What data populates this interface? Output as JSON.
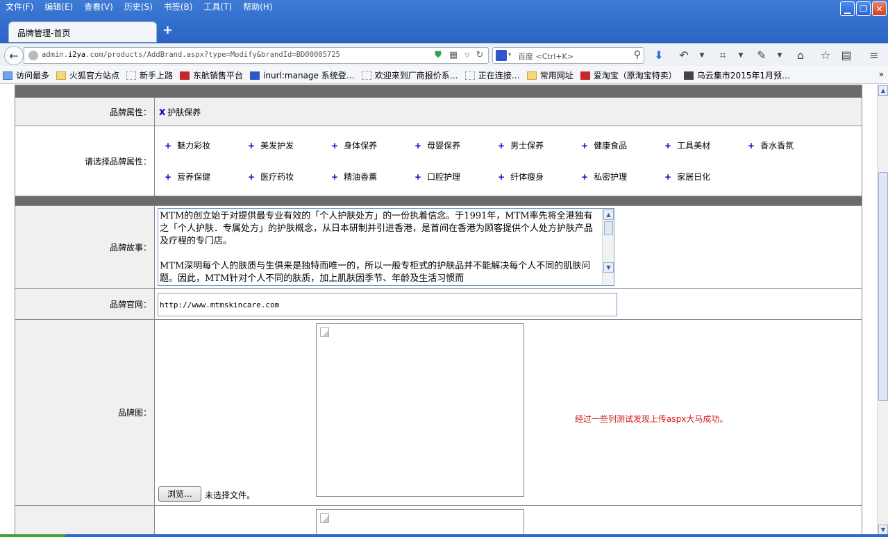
{
  "menu": [
    "文件(F)",
    "编辑(E)",
    "查看(V)",
    "历史(S)",
    "书签(B)",
    "工具(T)",
    "帮助(H)"
  ],
  "window_controls": {
    "minimize": "▁",
    "maximize": "❐",
    "close": "✕"
  },
  "tab": {
    "title": "品牌管理-首页",
    "new_tab": "+"
  },
  "address": {
    "host_prefix": "admin.",
    "host_bold": "i2ya",
    "rest": ".com/products/AddBrand.aspx?type=Modify&brandId=BD00005725"
  },
  "search": {
    "engine": "百度",
    "placeholder": "百度 <Ctrl+K>"
  },
  "bookmarks": [
    {
      "label": "访问最多",
      "icon": "sky"
    },
    {
      "label": "火狐官方站点",
      "icon": "folder"
    },
    {
      "label": "新手上路",
      "icon": "dashed"
    },
    {
      "label": "东航销售平台",
      "icon": "red"
    },
    {
      "label": "inurl:manage 系统登…",
      "icon": "blue"
    },
    {
      "label": "欢迎来到厂商报价系…",
      "icon": "dashed"
    },
    {
      "label": "正在连接…",
      "icon": "dashed"
    },
    {
      "label": "常用网址",
      "icon": "folder"
    },
    {
      "label": "爱淘宝（原淘宝特卖）",
      "icon": "red"
    },
    {
      "label": "乌云集市2015年1月预…",
      "icon": "dark"
    }
  ],
  "bookmarks_more": "»",
  "form": {
    "brand_attr_label": "品牌属性：",
    "selected_attr": {
      "remove": "X",
      "name": "护肤保养"
    },
    "choose_attr_label": "请选择品牌属性：",
    "attr_options": [
      "魅力彩妆",
      "美发护发",
      "身体保养",
      "母婴保养",
      "男士保养",
      "健康食品",
      "工具美材",
      "香水香氛",
      "营养保健",
      "医疗药妆",
      "精油香薰",
      "口腔护理",
      "纤体瘦身",
      "私密护理",
      "家居日化"
    ],
    "plus_symbol": "+",
    "story_label": "品牌故事：",
    "story_text": "MTM的创立始于对提供最专业有效的「个人护肤处方」的一份执着信念。于1991年，MTM率先将全港独有之「个人护肤．专属处方」的护肤概念，从日本研制并引进香港，是首间在香港为顾客提供个人处方护肤产品及疗程的专门店。\n\nMTM深明每个人的肤质与生俱来是独特而唯一的，所以一般专柜式的护肤品并不能解决每个人不同的肌肤问题。因此，MTM针对个人不同的肤质，加上肌肤因季节、年龄及生活习惯而",
    "site_label": "品牌官网：",
    "site_value": "http://www.mtmskincare.com",
    "pic_label": "品牌图：",
    "browse_button": "浏览…",
    "file_status": "未选择文件。",
    "note": "经过一些列测试发现上传aspx大马成功。"
  }
}
